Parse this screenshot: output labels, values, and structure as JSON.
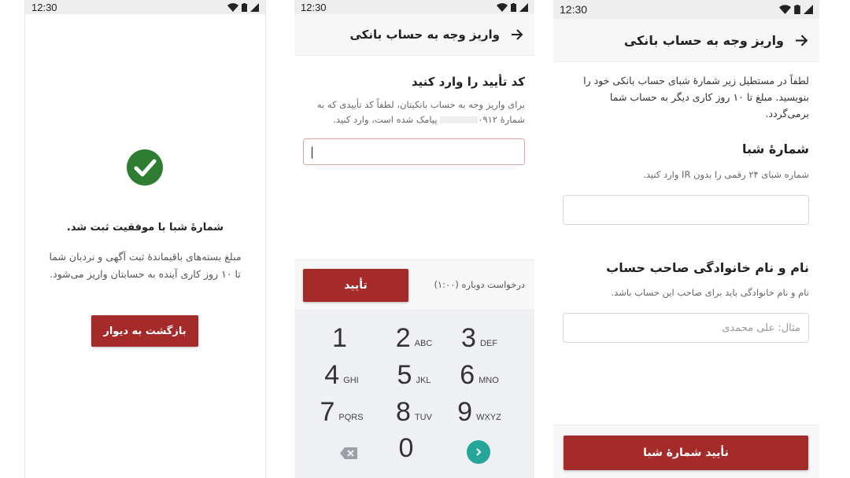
{
  "colors": {
    "brand_red": "#a52a2a",
    "success_green": "#2e7d32",
    "keypad_ok": "#26a69a"
  },
  "screen1": {
    "status": {
      "time": "12:30"
    },
    "title": "شمارهٔ شبا با موفقیت ثبت شد.",
    "description_line1": "مبلغ بسته‌های باقیماندهٔ ثبت آگهی و نردبان شما",
    "description_line2": "تا ۱۰ روز کاری آینده به حسابتان واریز می‌شود.",
    "back_button": "بازگشت به دیوار",
    "icon": "check-circle-icon"
  },
  "screen2": {
    "status": {
      "time": "12:30"
    },
    "toolbar_title": "واریز وجه به حساب بانکی",
    "heading": "کد تأیید را وارد کنید",
    "desc_line1": "برای واریز وجه به حساب بانکیتان، لطفاً کد تأییدی که به",
    "desc_line2_a": "شمارهٔ",
    "desc_line2_phone": "۰۹۱۲",
    "desc_line2_b": "پیامک شده است، وارد کنید.",
    "input_value": "|",
    "confirm_button": "تأیید",
    "resend": "درخواست دوباره (۱:۰۰)",
    "keypad": {
      "keys": [
        {
          "digit": "1",
          "letters": ""
        },
        {
          "digit": "2",
          "letters": "ABC"
        },
        {
          "digit": "3",
          "letters": "DEF"
        },
        {
          "digit": "4",
          "letters": "GHI"
        },
        {
          "digit": "5",
          "letters": "JKL"
        },
        {
          "digit": "6",
          "letters": "MNO"
        },
        {
          "digit": "7",
          "letters": "PQRS"
        },
        {
          "digit": "8",
          "letters": "TUV"
        },
        {
          "digit": "9",
          "letters": "WXYZ"
        },
        {
          "digit": "0",
          "letters": ""
        }
      ]
    }
  },
  "screen3": {
    "status": {
      "time": "12:30"
    },
    "toolbar_title": "واریز وجه به حساب بانکی",
    "intro_line1": "لطفاً در مستطیل زیر شمارهٔ شبای حساب بانکی خود را",
    "intro_line2": "بنویسید. مبلغ تا ۱۰ روز کاری دیگر به حساب شما برمی‌گردد.",
    "sheba_label": "شمارهٔ شبا",
    "sheba_hint": "شماره شبای ۲۴ رقمی را بدون IR وارد کنید.",
    "sheba_value": "",
    "name_label": "نام و نام خانوادگی صاحب حساب",
    "name_hint": "نام و نام خانوادگی باید برای صاحب این حساب باشد.",
    "name_placeholder": "مثال: علی محمدی",
    "confirm_button": "تأیید شمارهٔ شبا"
  }
}
